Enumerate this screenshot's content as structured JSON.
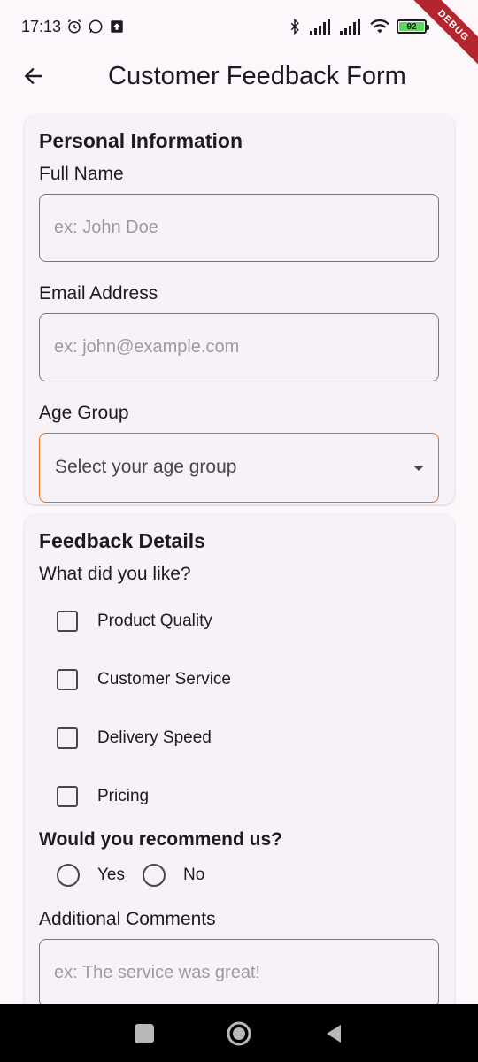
{
  "status_bar": {
    "time": "17:13",
    "battery": "92",
    "icons": [
      "alarm-icon",
      "whatsapp-icon",
      "upload-icon",
      "bluetooth-icon",
      "signal-icon",
      "signal-icon",
      "wifi-icon",
      "battery-icon"
    ]
  },
  "debug_banner": "DEBUG",
  "app_bar": {
    "title": "Customer Feedback Form",
    "back_icon": "arrow-back-icon"
  },
  "personal_info": {
    "title": "Personal Information",
    "full_name": {
      "label": "Full Name",
      "placeholder": "ex: John Doe",
      "value": ""
    },
    "email": {
      "label": "Email Address",
      "placeholder": "ex: john@example.com",
      "value": ""
    },
    "age_group": {
      "label": "Age Group",
      "placeholder": "Select your age group"
    }
  },
  "feedback": {
    "title": "Feedback Details",
    "liked_question": "What did you like?",
    "liked_options": [
      {
        "label": "Product Quality",
        "checked": false
      },
      {
        "label": "Customer Service",
        "checked": false
      },
      {
        "label": "Delivery Speed",
        "checked": false
      },
      {
        "label": "Pricing",
        "checked": false
      }
    ],
    "recommend_question": "Would you recommend us?",
    "recommend_options": [
      {
        "label": "Yes",
        "selected": false
      },
      {
        "label": "No",
        "selected": false
      }
    ],
    "comments": {
      "label": "Additional Comments",
      "placeholder": "ex: The service was great!",
      "value": ""
    }
  },
  "colors": {
    "background": "#fdf7fc",
    "card": "#f7f1f8",
    "accent_border": "#e0701c",
    "outline": "#79747e"
  }
}
